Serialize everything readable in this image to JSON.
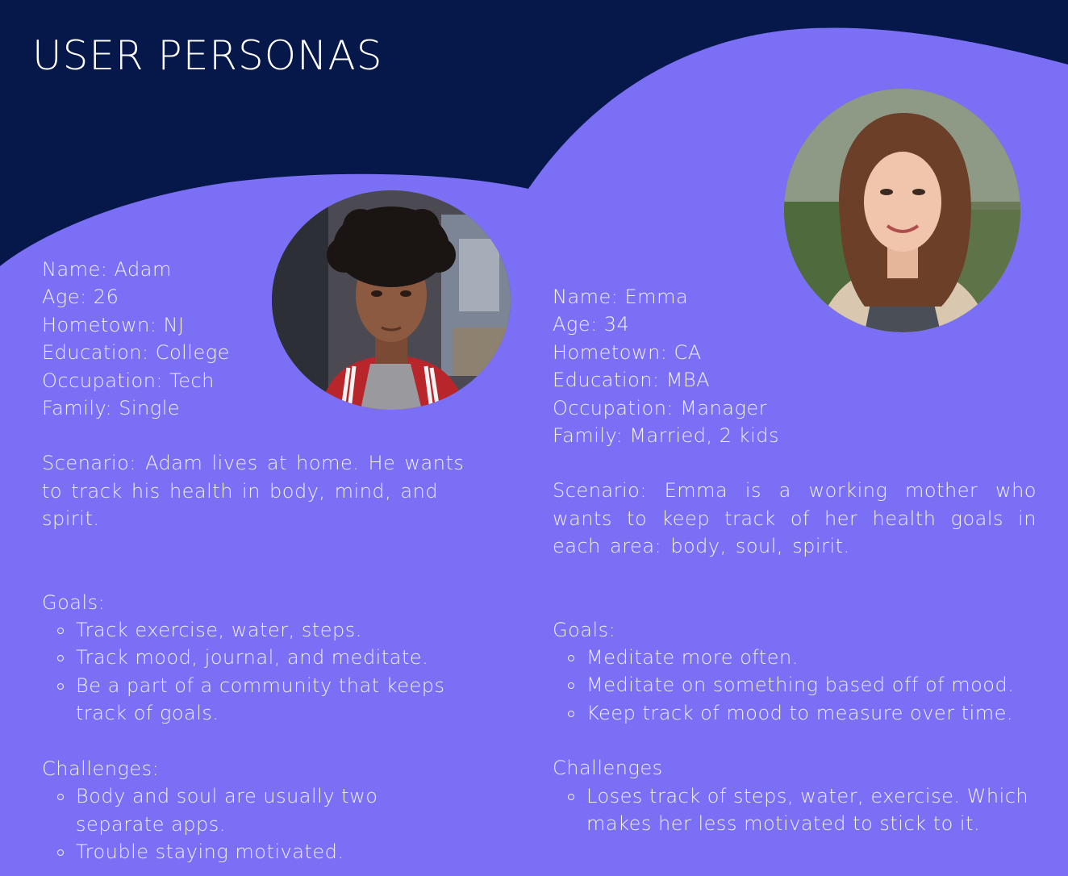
{
  "page": {
    "title": "USER PERSONAS",
    "colors": {
      "header_bg": "#06184a",
      "panel_bg": "#7b6ff5",
      "text": "#ffffff"
    }
  },
  "personas": [
    {
      "id": "adam",
      "photo_icon": "portrait-photo-young-man",
      "name_line": "Name: Adam",
      "age_line": "Age: 26",
      "hometown_line": "Hometown: NJ",
      "education_line": "Education: College",
      "occupation_line": "Occupation: Tech",
      "family_line": "Family: Single",
      "scenario": "Scenario: Adam lives at home. He wants to track his health in body, mind, and spirit.",
      "goals_heading": "Goals:",
      "goals": [
        "Track exercise, water, steps.",
        "Track mood, journal, and meditate.",
        "Be a part of a community that keeps track of goals."
      ],
      "challenges_heading": "Challenges:",
      "challenges": [
        "Body and soul are usually two separate apps.",
        "Trouble staying motivated."
      ]
    },
    {
      "id": "emma",
      "photo_icon": "portrait-photo-young-woman",
      "name_line": "Name: Emma",
      "age_line": "Age: 34",
      "hometown_line": "Hometown: CA",
      "education_line": "Education: MBA",
      "occupation_line": "Occupation: Manager",
      "family_line": "Family: Married, 2 kids",
      "scenario": "Scenario: Emma is a working mother who wants to keep track of her health goals in each area: body, soul, spirit.",
      "goals_heading": "Goals:",
      "goals": [
        "Meditate more often.",
        "Meditate on something based off of mood.",
        "Keep track of mood to measure over time."
      ],
      "challenges_heading": "Challenges",
      "challenges": [
        "Loses track of steps, water, exercise. Which makes her less motivated to stick to it."
      ]
    }
  ]
}
